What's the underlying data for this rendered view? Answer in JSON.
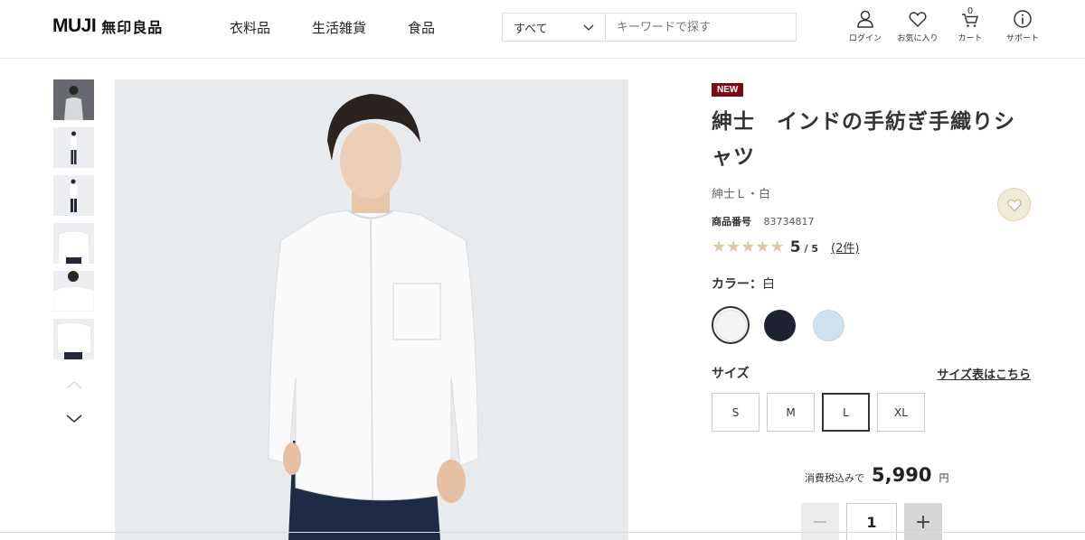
{
  "header": {
    "logo_text": "MUJI",
    "logo_jp": "無印良品",
    "nav": [
      "衣料品",
      "生活雑貨",
      "食品"
    ],
    "search": {
      "category": "すべて",
      "placeholder": "キーワードで探す"
    },
    "icons": [
      {
        "label": "ログイン",
        "icon": "user-icon"
      },
      {
        "label": "お気に入り",
        "icon": "heart-icon"
      },
      {
        "label": "カート",
        "icon": "cart-icon",
        "count": "0"
      },
      {
        "label": "サポート",
        "icon": "info-icon"
      }
    ]
  },
  "gallery": {
    "thumbnail_count": 6,
    "selected_index": 0
  },
  "product": {
    "badge": "NEW",
    "title": "紳士　インドの手紡ぎ手織りシャツ",
    "subtitle": "紳士Ｌ・白",
    "number_label": "商品番号",
    "number": "83734817",
    "rating": "5",
    "rating_max": "/ 5",
    "reviews": "(2件)",
    "color_label": "カラー：",
    "color_value": "白",
    "colors": [
      "#f4f4f4",
      "#1e2130",
      "#cfe1ea"
    ],
    "selected_color_index": 0,
    "size_label": "サイズ",
    "size_guide": "サイズ表はこちら",
    "sizes": [
      "S",
      "M",
      "L",
      "XL"
    ],
    "selected_size": "L",
    "tax_label": "消費税込みで",
    "price": "5,990",
    "currency": "円",
    "quantity": "1",
    "qty_minus": "−",
    "qty_plus": "+"
  }
}
